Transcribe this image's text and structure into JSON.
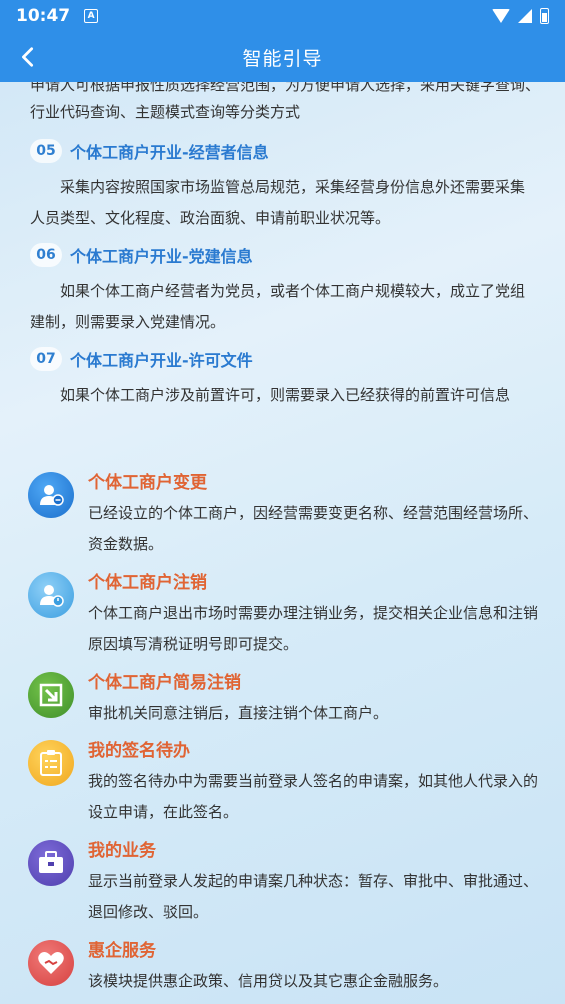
{
  "status": {
    "time": "10:47",
    "notif": "A"
  },
  "nav": {
    "title": "智能引导"
  },
  "intro_cut": "申请人可根据申报性质选择经营范围，为方便申请人选择，采用关键字查询、行业代码查询、主题模式查询等分类方式",
  "steps": [
    {
      "num": "05",
      "title": "个体工商户开业-经营者信息",
      "desc": "采集内容按照国家市场监管总局规范，采集经营身份信息外还需要采集人员类型、文化程度、政治面貌、申请前职业状况等。"
    },
    {
      "num": "06",
      "title": "个体工商户开业-党建信息",
      "desc": "如果个体工商户经营者为党员，或者个体工商户规模较大，成立了党组建制，则需要录入党建情况。"
    },
    {
      "num": "07",
      "title": "个体工商户开业-许可文件",
      "desc": "如果个体工商户涉及前置许可，则需要录入已经获得的前置许可信息"
    }
  ],
  "features": [
    {
      "icon": "person-edit-icon",
      "title": "个体工商户变更",
      "desc": "已经设立的个体工商户，因经营需要变更名称、经营范围经营场所、资金数据。"
    },
    {
      "icon": "person-power-icon",
      "title": "个体工商户注销",
      "desc": "个体工商户退出市场时需要办理注销业务，提交相关企业信息和注销原因填写清税证明号即可提交。"
    },
    {
      "icon": "exit-arrow-icon",
      "title": "个体工商户简易注销",
      "desc": "审批机关同意注销后，直接注销个体工商户。"
    },
    {
      "icon": "clipboard-icon",
      "title": "我的签名待办",
      "desc": "我的签名待办中为需要当前登录人签名的申请案，如其他人代录入的设立申请，在此签名。"
    },
    {
      "icon": "briefcase-icon",
      "title": "我的业务",
      "desc": "显示当前登录人发起的申请案几种状态：暂存、审批中、审批通过、退回修改、驳回。"
    },
    {
      "icon": "heart-hand-icon",
      "title": "惠企服务",
      "desc": "该模块提供惠企政策、信用贷以及其它惠企金融服务。"
    }
  ],
  "colors": {
    "primary": "#2f8fe8",
    "accent_title": "#e06434",
    "step_title": "#2a7ad0"
  }
}
